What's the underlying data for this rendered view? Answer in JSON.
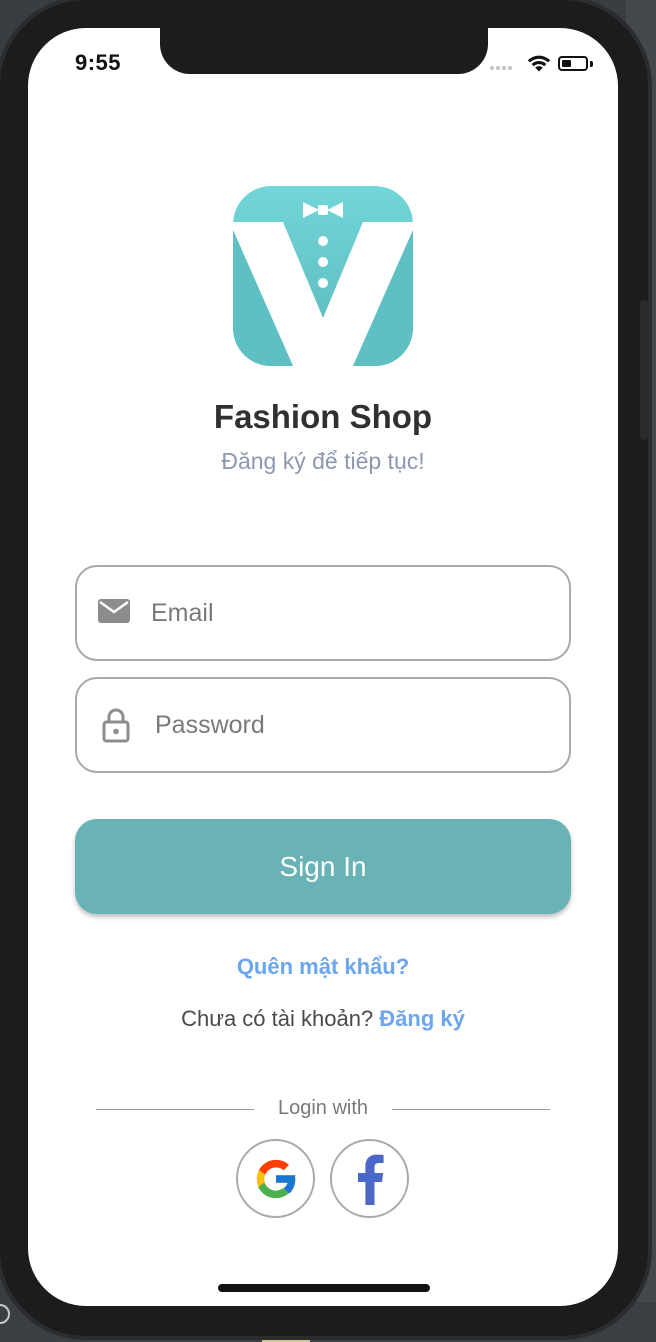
{
  "status_bar": {
    "time": "9:55"
  },
  "app": {
    "name": "Fashion Shop",
    "subtitle": "Đăng ký để tiếp tục!"
  },
  "form": {
    "email_placeholder": "Email",
    "password_placeholder": "Password",
    "signin_label": "Sign In"
  },
  "links": {
    "forgot_password": "Quên mật khẩu?",
    "no_account_prompt": "Chưa có tài khoản?",
    "signup_label": "Đăng ký"
  },
  "social_login": {
    "label": "Login with",
    "providers": [
      "google",
      "facebook"
    ]
  },
  "colors": {
    "brand": "#69b2b5",
    "link": "#6ba6ee",
    "subtitle": "#8d97b0",
    "facebook": "#4a68c8"
  },
  "icons": [
    "wifi-icon",
    "battery-icon",
    "email-icon",
    "lock-icon",
    "google-icon",
    "facebook-icon"
  ]
}
